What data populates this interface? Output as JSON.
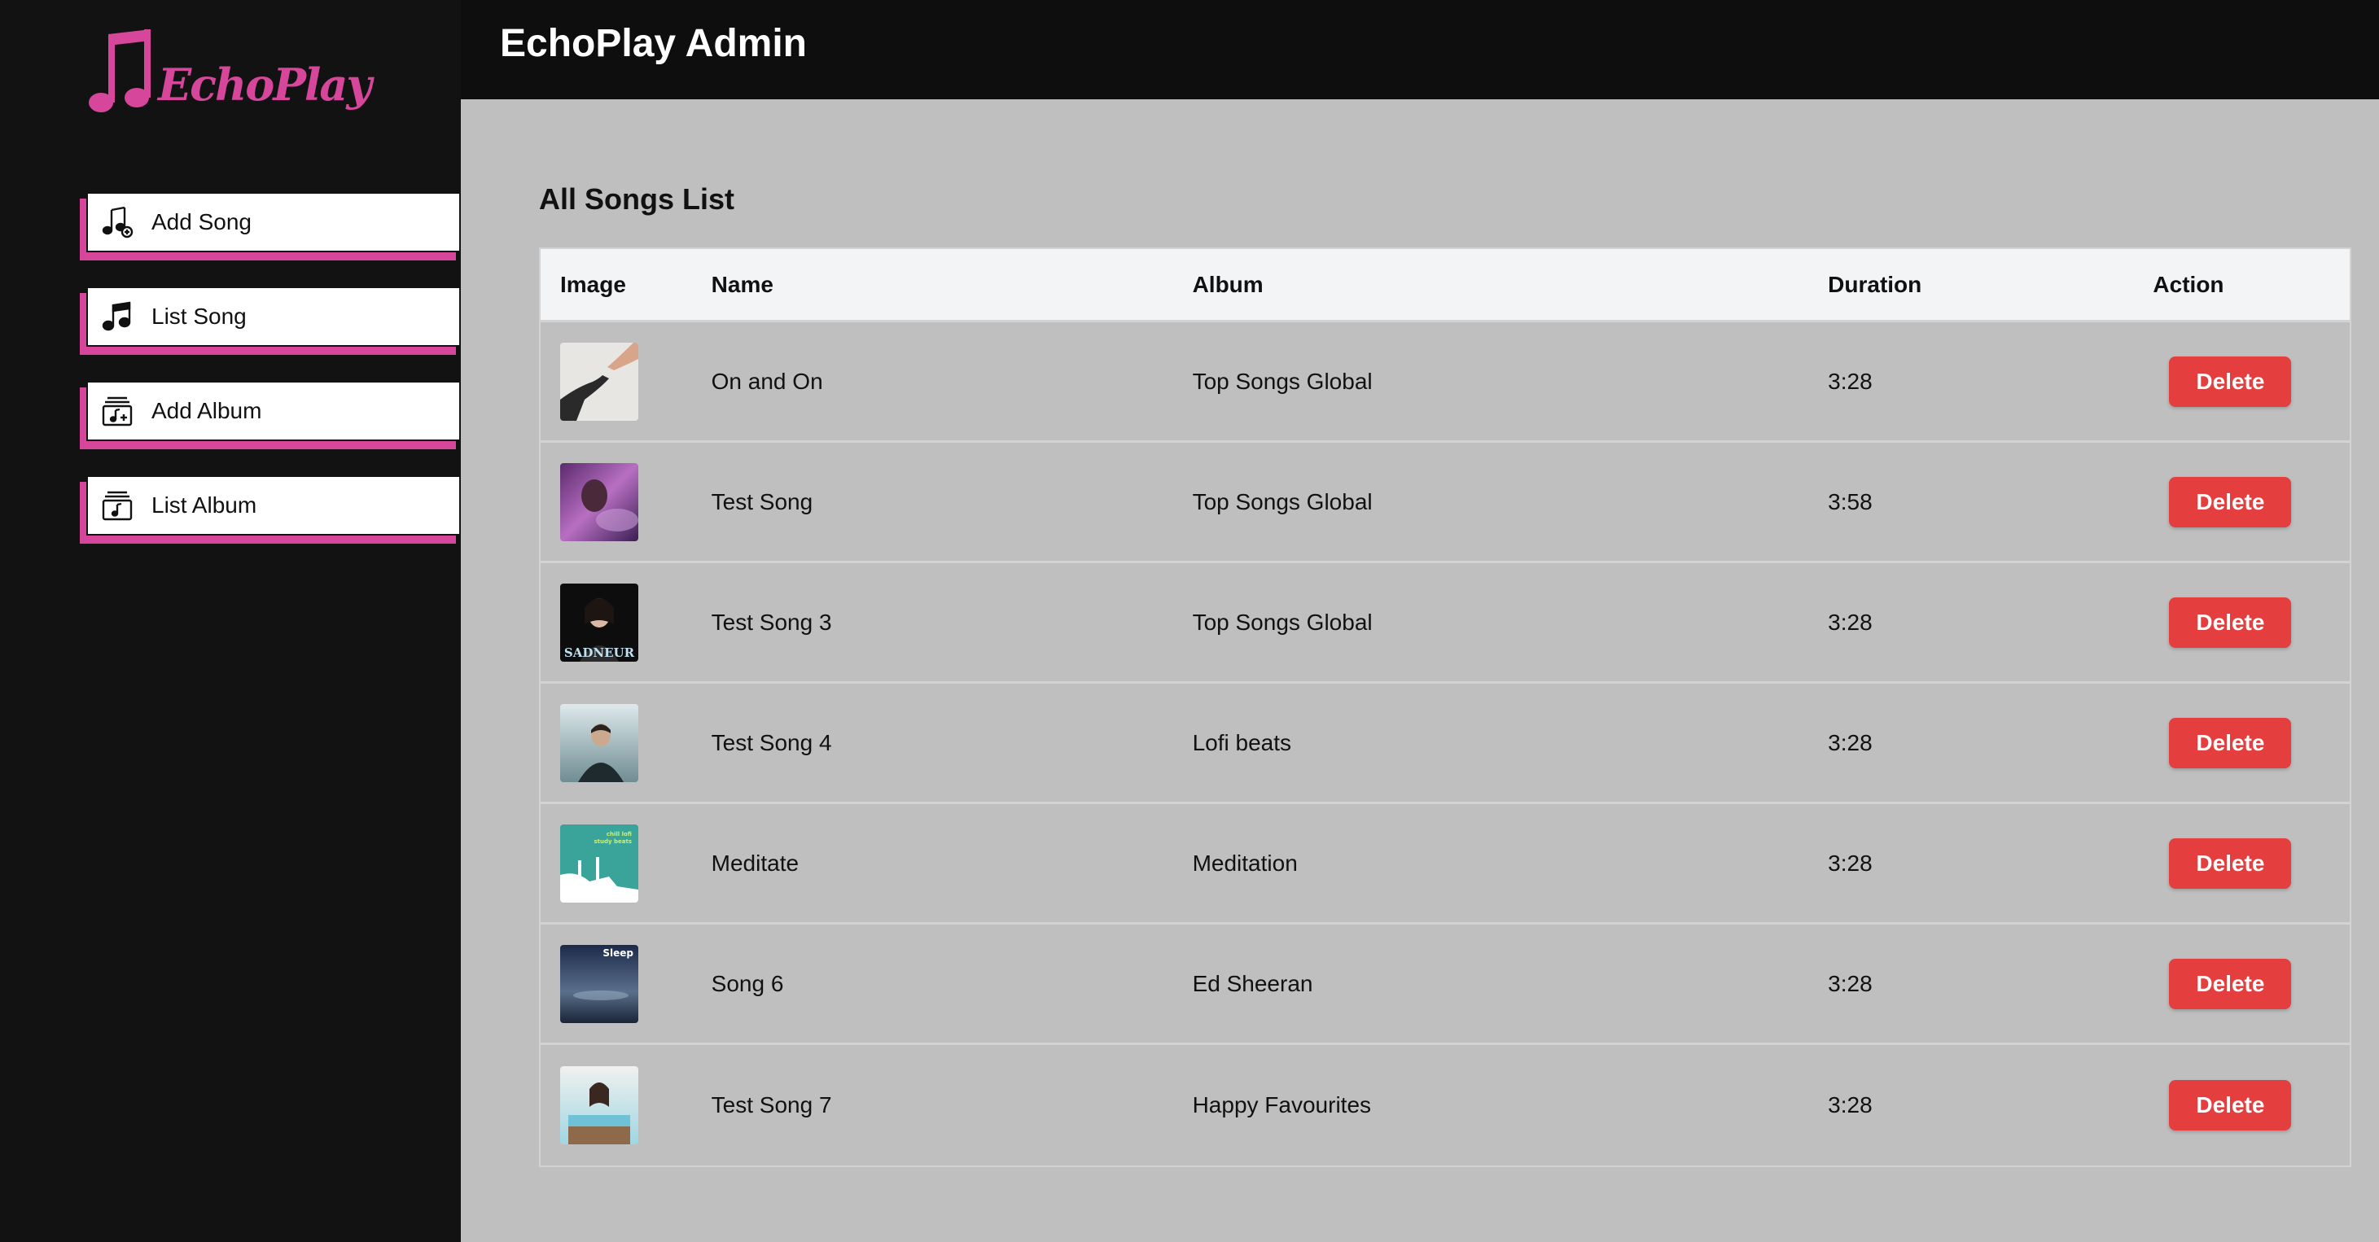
{
  "brand": {
    "name": "EchoPlay",
    "color": "#d6479b"
  },
  "header": {
    "title": "EchoPlay Admin"
  },
  "sidebar": {
    "items": [
      {
        "label": "Add Song",
        "icon": "music-note-add-icon"
      },
      {
        "label": "List Song",
        "icon": "music-note-icon"
      },
      {
        "label": "Add Album",
        "icon": "album-add-icon"
      },
      {
        "label": "List Album",
        "icon": "album-list-icon"
      }
    ]
  },
  "main": {
    "title": "All Songs List",
    "columns": [
      "Image",
      "Name",
      "Album",
      "Duration",
      "Action"
    ],
    "rows": [
      {
        "name": "On and On",
        "album": "Top Songs Global",
        "duration": "3:28",
        "action": "Delete",
        "thumb_text": ""
      },
      {
        "name": "Test Song",
        "album": "Top Songs Global",
        "duration": "3:58",
        "action": "Delete",
        "thumb_text": ""
      },
      {
        "name": "Test Song 3",
        "album": "Top Songs Global",
        "duration": "3:28",
        "action": "Delete",
        "thumb_text": "SADNEUR"
      },
      {
        "name": "Test Song 4",
        "album": "Lofi beats",
        "duration": "3:28",
        "action": "Delete",
        "thumb_text": ""
      },
      {
        "name": "Meditate",
        "album": "Meditation",
        "duration": "3:28",
        "action": "Delete",
        "thumb_text": "chill lofi study beats"
      },
      {
        "name": "Song 6",
        "album": "Ed Sheeran",
        "duration": "3:28",
        "action": "Delete",
        "thumb_text": "Sleep"
      },
      {
        "name": "Test Song 7",
        "album": "Happy Favourites",
        "duration": "3:28",
        "action": "Delete",
        "thumb_text": ""
      }
    ]
  },
  "colors": {
    "delete": "#e53e3e",
    "sidebar_bg": "#121212",
    "accent": "#d6479b"
  }
}
